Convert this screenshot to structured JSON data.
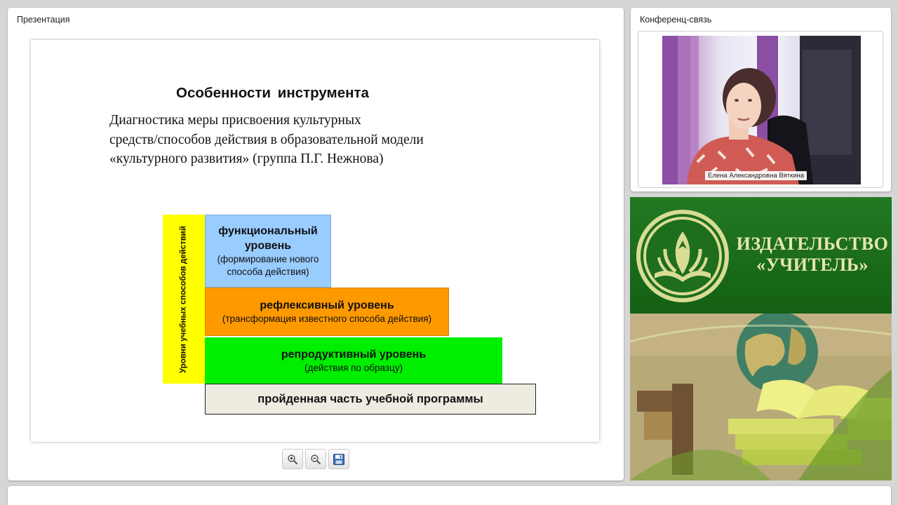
{
  "presentation": {
    "title": "Презентация",
    "slide": {
      "heading": "Особенности  инструмента",
      "subtitle": "Диагностика  меры присвоения культурных\nсредств/способов действия  в образовательной модели\n«культурного  развития» (группа  П.Г. Нежнова)",
      "diagram": {
        "axis_label": "Уровни учебных способов действий",
        "levels": [
          {
            "name": "функциональный уровень",
            "desc": "(формирование нового способа действия)",
            "color": "#99ccff"
          },
          {
            "name": "рефлексивный уровень",
            "desc": "(трансформация известного способа действия)",
            "color": "#ff9900"
          },
          {
            "name": "репродуктивный уровень",
            "desc": "(действия по образцу)",
            "color": "#00ee00"
          },
          {
            "name": "пройденная часть учебной программы",
            "desc": "",
            "color": "#eeece1"
          }
        ]
      }
    },
    "toolbar": {
      "zoom_in": "zoom-in-icon",
      "zoom_out": "zoom-out-icon",
      "save": "save-icon"
    }
  },
  "conference": {
    "title": "Конференц-связь",
    "participant_name": "Елена Александровна Вяткина"
  },
  "banner": {
    "line1": "ИЗДАТЕЛЬСТВО",
    "line2": "«УЧИТЕЛЬ»",
    "colors": {
      "green": "#1d6b1d",
      "text": "#e6e7b0"
    }
  }
}
